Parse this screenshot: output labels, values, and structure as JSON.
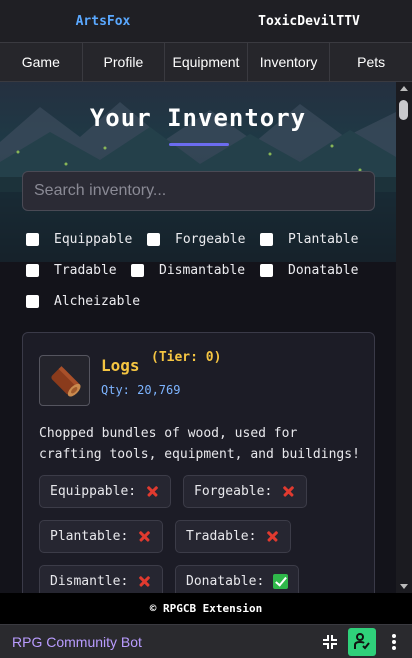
{
  "topbar": {
    "left_user": "ArtsFox",
    "right_user": "ToxicDevilTTV"
  },
  "nav": {
    "tabs": [
      "Game",
      "Profile",
      "Equipment",
      "Inventory",
      "Pets"
    ]
  },
  "page": {
    "title": "Your Inventory"
  },
  "search": {
    "placeholder": "Search inventory..."
  },
  "filters": [
    "Equippable",
    "Forgeable",
    "Plantable",
    "Tradable",
    "Dismantable",
    "Donatable",
    "Alcheizable"
  ],
  "item": {
    "name": "Logs",
    "tier": "(Tier: 0)",
    "qty": "Qty: 20,769",
    "description": "Chopped bundles of wood, used for crafting tools, equipment, and buildings!",
    "properties": [
      {
        "label": "Equippable:",
        "value": false
      },
      {
        "label": "Forgeable:",
        "value": false
      },
      {
        "label": "Plantable:",
        "value": false
      },
      {
        "label": "Tradable:",
        "value": false
      },
      {
        "label": "Dismantle:",
        "value": false
      },
      {
        "label": "Donatable:",
        "value": true
      }
    ]
  },
  "footer": {
    "text": "© RPGCB Extension"
  },
  "extension_bar": {
    "name": "RPG Community Bot",
    "icons": [
      "collapse-icon",
      "pin-icon",
      "more-vertical-icon"
    ]
  },
  "colors": {
    "accent": "#6c6cf0",
    "item_name": "#f5c542",
    "qty": "#7db4ff",
    "ext_name": "#b99cff",
    "yes": "#2fb84a",
    "no": "#e03a2f"
  }
}
